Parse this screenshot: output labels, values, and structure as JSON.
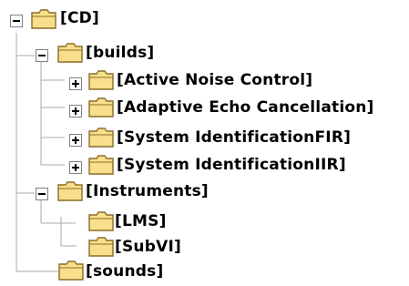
{
  "tree": {
    "root": {
      "label": "[CD]",
      "expanded": true,
      "children": [
        {
          "label": "[builds]",
          "expanded": true,
          "children": [
            {
              "label": "[Active Noise Control]",
              "expanded": false
            },
            {
              "label": "[Adaptive Echo Cancellation]",
              "expanded": false
            },
            {
              "label": "[System IdentificationFIR]",
              "expanded": false
            },
            {
              "label": "[System IdentificationIIR]",
              "expanded": false
            }
          ]
        },
        {
          "label": "[Instruments]",
          "expanded": true,
          "children": [
            {
              "label": "[LMS]"
            },
            {
              "label": "[SubVI]"
            }
          ]
        },
        {
          "label": "[sounds]"
        }
      ]
    }
  },
  "colors": {
    "folder_fill": "#f8df8c",
    "folder_stroke": "#8c6d2a",
    "tree_lines": "#a8a8a8",
    "text": "#000000"
  },
  "icons": {
    "expanded": "minus-box-icon",
    "collapsed": "plus-box-icon",
    "folder": "folder-icon"
  }
}
